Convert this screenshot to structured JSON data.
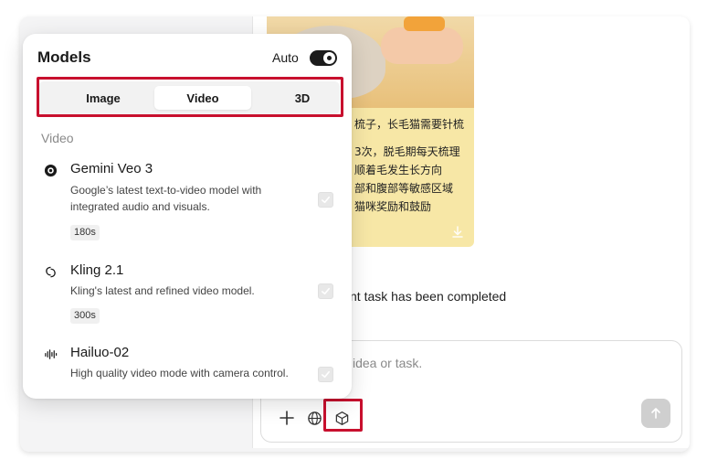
{
  "models_panel": {
    "title": "Models",
    "auto_label": "Auto",
    "auto_enabled": true,
    "tabs": [
      {
        "label": "Image",
        "active": false
      },
      {
        "label": "Video",
        "active": true
      },
      {
        "label": "3D",
        "active": false
      }
    ],
    "section_label": "Video",
    "models": [
      {
        "name": "Gemini Veo 3",
        "description": "Google’s latest text-to-video model with integrated audio and visuals.",
        "duration": "180s",
        "icon": "gemini-icon"
      },
      {
        "name": "Kling 2.1",
        "description": "Kling's latest and refined video model.",
        "duration": "300s",
        "icon": "kling-icon"
      },
      {
        "name": "Hailuo-02",
        "description": "High quality video mode with camera control.",
        "icon": "hailuo-icon"
      }
    ]
  },
  "chat": {
    "doc_lines": [
      "梳子，长毛猫需要针梳",
      "3次，脱毛期每天梳理",
      "顺着毛发生长方向",
      "部和腹部等敏感区域",
      "猫咪奖励和鼓励"
    ],
    "completed_text": "nt task has been completed",
    "composer_placeholder": "idea or task.",
    "icons": [
      "plus-icon",
      "globe-icon",
      "cube-icon",
      "arrow-up-icon"
    ]
  },
  "colors": {
    "highlight": "#c8102e",
    "toggle_on": "#1c1c1c"
  }
}
